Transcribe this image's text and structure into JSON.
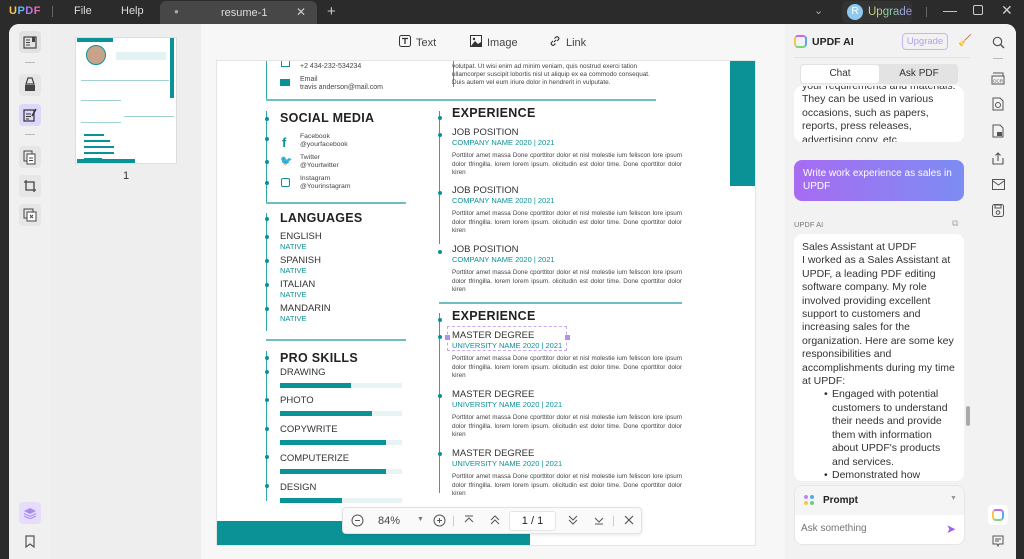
{
  "titlebar": {
    "logo": [
      "U",
      "P",
      "D",
      "F"
    ],
    "menu": {
      "file": "File",
      "help": "Help"
    },
    "tab": {
      "dot": "●",
      "name": "resume-1",
      "close": "✕"
    },
    "new_tab": "+",
    "dropdown": "⌄",
    "avatar_initial": "R",
    "upgrade": "Upgrade",
    "win": {
      "min": "—",
      "close": "✕"
    }
  },
  "edit_toolbar": {
    "text": "Text",
    "image": "Image",
    "link": "Link"
  },
  "thumbnail": {
    "page_number": "1"
  },
  "resume": {
    "phone": "+2 434-232-534234",
    "email_label": "Email",
    "email": "travis anderson@mail.com",
    "about_lines": [
      "volutpat. Ut wisi enim ad minim veniam, quis nostrud exerci tation",
      "ullamcorper suscipit lobortis nisl ut aliquip ex ea commodo consequat.",
      "Duis autem vel eum iriure dolor in hendrerit in vulputate."
    ],
    "social_title": "SOCIAL MEDIA",
    "social": [
      {
        "name": "Facebook",
        "handle": "@yourfacebook"
      },
      {
        "name": "Twitter",
        "handle": "@Yourtwitter"
      },
      {
        "name": "Instagram",
        "handle": "@Yourinstagram"
      }
    ],
    "languages_title": "LANGUAGES",
    "languages": [
      {
        "name": "ENGLISH",
        "level": "NATIVE"
      },
      {
        "name": "SPANISH",
        "level": "NATIVE"
      },
      {
        "name": "ITALIAN",
        "level": "NATIVE"
      },
      {
        "name": "MANDARIN",
        "level": "NATIVE"
      }
    ],
    "skills_title": "PRO SKILLS",
    "skills": [
      {
        "name": "DRAWING",
        "level": 0.58
      },
      {
        "name": "PHOTO",
        "level": 0.75
      },
      {
        "name": "COPYWRITE",
        "level": 0.87
      },
      {
        "name": "COMPUTERIZE",
        "level": 0.87
      },
      {
        "name": "DESIGN",
        "level": 0.51
      }
    ],
    "experience_title": "EXPERIENCE",
    "jobs": [
      {
        "title": "JOB POSITION",
        "company": "COMPANY NAME 2020 | 2021"
      },
      {
        "title": "JOB POSITION",
        "company": "COMPANY NAME 2020 | 2021"
      },
      {
        "title": "JOB POSITION",
        "company": "COMPANY NAME 2020 | 2021"
      }
    ],
    "education_title": "EXPERIENCE",
    "degrees": [
      {
        "title": "MASTER DEGREE",
        "school": "UNIVERSITY NAME 2020 | 2021"
      },
      {
        "title": "MASTER DEGREE",
        "school": "UNIVERSITY NAME 2020 | 2021"
      },
      {
        "title": "MASTER DEGREE",
        "school": "UNIVERSITY NAME 2020 | 2021"
      }
    ],
    "lorem": "Porttitor amet massa Done cporttitor dolor et nisl molestie ium feliscon lore ipsum dolor tfringilla. lorem lorem ipsum. olicitudin est dolor time. Done cporttitor dolor kiren"
  },
  "zoombar": {
    "zoom": "84%",
    "page": "1 / 1"
  },
  "ai": {
    "title": "UPDF AI",
    "upgrade": "Upgrade",
    "tabs": {
      "chat": "Chat",
      "ask_pdf": "Ask PDF"
    },
    "prev_response": "your requirements and materials. They can be used in various occasions, such as papers, reports, press releases, advertising copy, etc.",
    "user_message": "Write work experience as sales in UPDF",
    "ai_label": "UPDF AI",
    "response_title": "Sales Assistant at UPDF",
    "response_body": "I worked as a Sales Assistant at UPDF, a leading PDF editing software company. My role involved providing excellent support to customers and increasing sales for the organization. Here are some key responsibilities and accomplishments during my time at UPDF:",
    "bullets": [
      "Engaged with potential customers to understand their needs and provide them with information about UPDF's products and services.",
      "Demonstrated how UPDF's software could solve their"
    ],
    "prompt_label": "Prompt",
    "ask_placeholder": "Ask something"
  },
  "colors": {
    "accent": "#0b9296",
    "ai_purple": "#a76cf2"
  }
}
